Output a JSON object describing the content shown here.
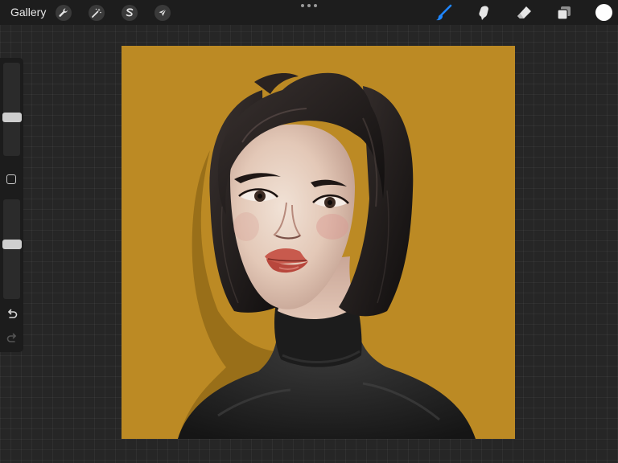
{
  "topbar": {
    "gallery_label": "Gallery",
    "left_tools": [
      "wrench-icon",
      "magic-wand-icon",
      "selection-s-icon",
      "transform-arrow-icon"
    ],
    "right_tools": [
      "brush-icon",
      "smudge-icon",
      "eraser-icon",
      "layers-icon"
    ],
    "active_tool": "brush-icon",
    "current_color": "#ffffff",
    "accent_color": "#1f86ff"
  },
  "sidebar": {
    "brush_size_level": 0.4,
    "opacity_level": 0.55,
    "undo_icon": "undo-icon",
    "redo_icon": "redo-icon"
  },
  "canvas": {
    "background_color": "#bc8a24",
    "artwork": "portrait-illustration"
  }
}
